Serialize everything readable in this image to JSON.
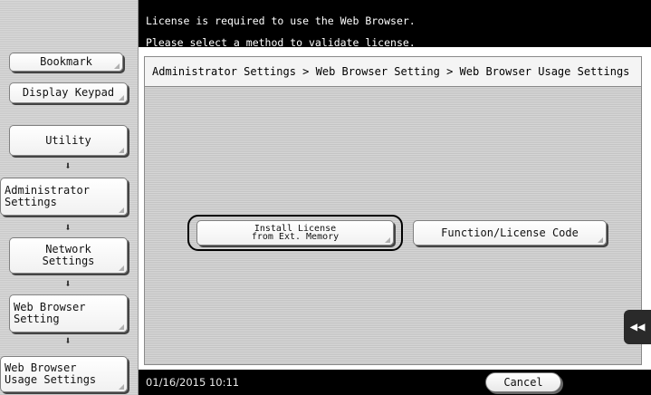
{
  "message": {
    "line1": "License is required to use the Web Browser.",
    "line2": "Please select a method to validate license."
  },
  "sidebar": {
    "bookmark_label": "Bookmark",
    "display_keypad_label": "Display Keypad",
    "items": [
      {
        "label": "Utility"
      },
      {
        "label": "Administrator\nSettings"
      },
      {
        "label": "Network\nSettings"
      },
      {
        "label": "Web Browser\nSetting"
      },
      {
        "label": "Web Browser\nUsage Settings"
      }
    ],
    "arrow_icon": "down-arrow-icon"
  },
  "breadcrumb": "Administrator Settings > Web Browser Setting > Web Browser Usage Settings",
  "actions": {
    "install_license_label": "Install License\nfrom Ext. Memory",
    "function_license_label": "Function/License Code"
  },
  "side_tab_icon": "double-left-arrow-icon",
  "footer": {
    "datetime": "01/16/2015  10:11",
    "cancel_label": "Cancel"
  }
}
